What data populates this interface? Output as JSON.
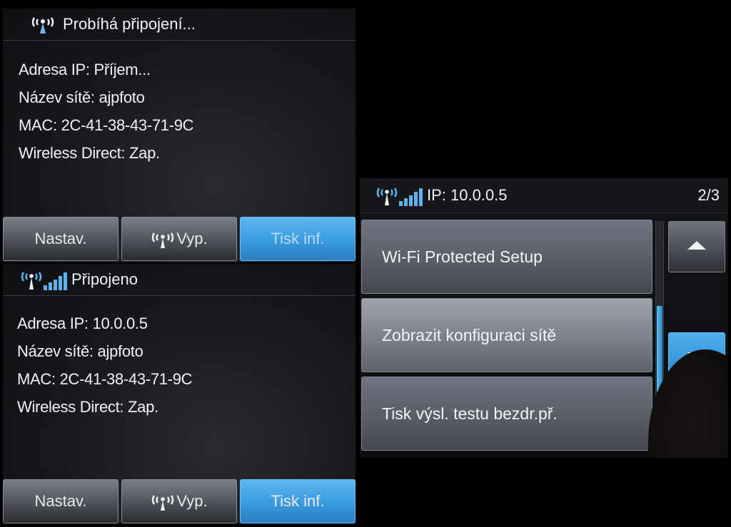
{
  "colors": {
    "accent": "#3b9ee0",
    "background": "#17181d"
  },
  "screen1": {
    "status": {
      "icon": "wifi-connecting-icon",
      "text": "Probíhá připojení..."
    },
    "info": {
      "ip": "Adresa IP: Příjem...",
      "network": "Název sítě: ajpfoto",
      "mac": "MAC: 2C-41-38-43-71-9C",
      "wireless_direct": "Wireless Direct: Zap."
    },
    "buttons": {
      "settings": "Nastav.",
      "wireless_off": "Vyp.",
      "print_info": "Tisk inf."
    }
  },
  "screen2": {
    "status": {
      "icon": "wifi-signal-icon",
      "text": "Připojeno"
    },
    "info": {
      "ip": "Adresa IP: 10.0.0.5",
      "network": "Název sítě: ajpfoto",
      "mac": "MAC: 2C-41-38-43-71-9C",
      "wireless_direct": "Wireless Direct: Zap."
    },
    "buttons": {
      "settings": "Nastav.",
      "wireless_off": "Vyp.",
      "print_info": "Tisk inf."
    }
  },
  "screen3": {
    "status": {
      "icon": "wifi-signal-icon",
      "text": "IP: 10.0.0.5",
      "page": "2/3"
    },
    "menu": [
      {
        "label": "Wi-Fi Protected Setup"
      },
      {
        "label": "Zobrazit konfiguraci sítě"
      },
      {
        "label": "Tisk výsl. testu bezdr.př."
      }
    ]
  }
}
